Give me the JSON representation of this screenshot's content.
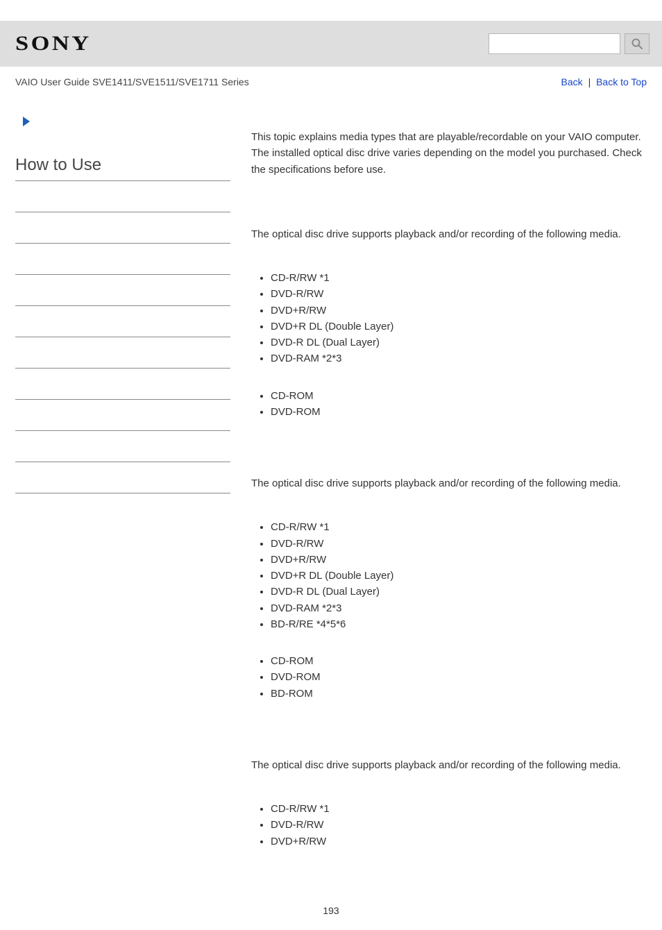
{
  "header": {
    "logo_text": "SONY",
    "search_placeholder": ""
  },
  "subheader": {
    "title": "VAIO User Guide SVE1411/SVE1511/SVE1711 Series",
    "nav": {
      "back_label": "Back",
      "top_label": "Back to Top",
      "separator": "|"
    }
  },
  "sidebar": {
    "heading": "How to Use",
    "rule_count": 10
  },
  "main": {
    "intro": "This topic explains media types that are playable/recordable on your VAIO computer. The installed optical disc drive varies depending on the model you purchased. Check the specifications before use.",
    "sections": [
      {
        "intro": "The optical disc drive supports playback and/or recording of the following media.",
        "groups": [
          [
            "CD-R/RW *1",
            "DVD-R/RW",
            "DVD+R/RW",
            "DVD+R DL (Double Layer)",
            "DVD-R DL (Dual Layer)",
            "DVD-RAM *2*3"
          ],
          [
            "CD-ROM",
            "DVD-ROM"
          ]
        ]
      },
      {
        "intro": "The optical disc drive supports playback and/or recording of the following media.",
        "groups": [
          [
            "CD-R/RW *1",
            "DVD-R/RW",
            "DVD+R/RW",
            "DVD+R DL (Double Layer)",
            "DVD-R DL (Dual Layer)",
            "DVD-RAM *2*3",
            "BD-R/RE *4*5*6"
          ],
          [
            "CD-ROM",
            "DVD-ROM",
            "BD-ROM"
          ]
        ]
      },
      {
        "intro": "The optical disc drive supports playback and/or recording of the following media.",
        "groups": [
          [
            "CD-R/RW *1",
            "DVD-R/RW",
            "DVD+R/RW"
          ]
        ]
      }
    ]
  },
  "page_number": "193"
}
